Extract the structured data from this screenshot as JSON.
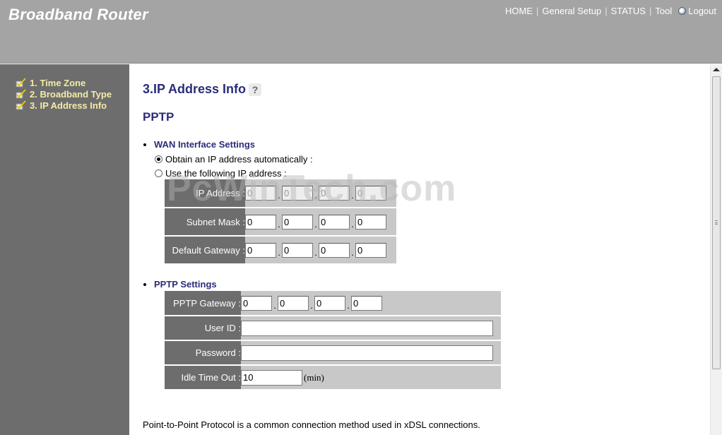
{
  "header": {
    "brand": "Broadband Router",
    "nav": {
      "home": "HOME",
      "general": "General Setup",
      "status": "STATUS",
      "tool": "Tool",
      "logout": "Logout"
    }
  },
  "sidebar": {
    "items": [
      {
        "label": "1. Time Zone"
      },
      {
        "label": "2. Broadband Type"
      },
      {
        "label": "3. IP Address Info"
      }
    ]
  },
  "main": {
    "title": "3.IP Address Info",
    "section": "PPTP",
    "wan": {
      "heading": "WAN Interface Settings",
      "radio_auto": "Obtain an IP address automatically :",
      "radio_manual": "Use the following IP address :",
      "ip_label": "IP Address :",
      "ip": [
        "0",
        "0",
        "0",
        "0"
      ],
      "mask_label": "Subnet Mask :",
      "mask": [
        "0",
        "0",
        "0",
        "0"
      ],
      "gw_label": "Default Gateway :",
      "gw": [
        "0",
        "0",
        "0",
        "0"
      ]
    },
    "pptp": {
      "heading": "PPTP Settings",
      "gateway_label": "PPTP Gateway :",
      "gateway": [
        "0",
        "0",
        "0",
        "0"
      ],
      "userid_label": "User ID :",
      "userid": "",
      "password_label": "Password :",
      "password": "",
      "idle_label": "Idle Time Out :",
      "idle": "10",
      "idle_unit": "(min)"
    },
    "footer": "Point-to-Point Protocol is a common connection method used in xDSL connections.",
    "watermark": "PcWinTech.com"
  }
}
